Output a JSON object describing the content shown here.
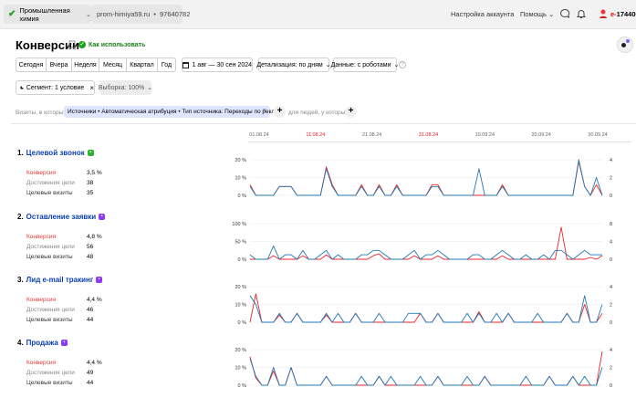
{
  "header": {
    "counter_label": "Промышленная химия",
    "site": "prom-himiya59.ru",
    "counter_id": "97640782",
    "account_settings": "Настройка аккаунта",
    "help": "Помощь",
    "user_id_prefix": "e-",
    "user_id": "1744009"
  },
  "page": {
    "title": "Конверсии",
    "how_to_use": "Как использовать"
  },
  "toolbar": {
    "periods": [
      "Сегодня",
      "Вчера",
      "Неделя",
      "Месяц",
      "Квартал",
      "Год"
    ],
    "date_range": "1 авг — 30 сен 2024",
    "detail": "Детализация: по дням",
    "data": "Данные: с роботами"
  },
  "segment": {
    "label": "Сегмент: 1 условие",
    "sample": "Выборка: 100%"
  },
  "filter": {
    "visits_prefix": "Визиты, в которых",
    "chip": "Источники • Автоматическая атрибуция • Тип источника: Переходы по рекламе",
    "people_suffix": "для людей, у которых"
  },
  "dates": [
    "01.08.24",
    "11.08.24",
    "21.08.24",
    "31.08.24",
    "10.09.24",
    "20.09.24",
    "30.09.24"
  ],
  "weekend_dates": [
    "11.08.24",
    "31.08.24"
  ],
  "metric_labels": {
    "conversion": "Конверсия",
    "reaches": "Достижения цели",
    "visits": "Целевые визиты"
  },
  "colors": {
    "conversion": "#e8262b",
    "visits": "#1f78b4",
    "link": "#0a3fae"
  },
  "goals": [
    {
      "number": "1.",
      "name": "Целевой звонок",
      "badge_icon": "phone-icon",
      "badge_color": "#2fb52f",
      "conversion": "3,5 %",
      "reaches": "38",
      "visits": "35",
      "left_axis": [
        "20 %",
        "10 %",
        "0 %"
      ],
      "right_axis": [
        "4",
        "2",
        "0"
      ],
      "conv_max": 20,
      "visits_max": 4,
      "conv_series": [
        6,
        0,
        0,
        0,
        0,
        5,
        5,
        5,
        0,
        0,
        0,
        0,
        0,
        16,
        6,
        0,
        0,
        0,
        0,
        6,
        0,
        0,
        6,
        0,
        0,
        6,
        0,
        0,
        0,
        0,
        0,
        6,
        6,
        0,
        0,
        0,
        0,
        0,
        0,
        0,
        0,
        0,
        0,
        6,
        0,
        0,
        0,
        0,
        0,
        0,
        0,
        0,
        0,
        0,
        0,
        0,
        19,
        5,
        0,
        6,
        0
      ],
      "visits_series": [
        1,
        0,
        0,
        0,
        0,
        1,
        1,
        1,
        0,
        0,
        0,
        0,
        0,
        3,
        1,
        0,
        0,
        0,
        0,
        1,
        0,
        0,
        1,
        0,
        0,
        1,
        0,
        0,
        0,
        0,
        0,
        1,
        1,
        0,
        0,
        0,
        0,
        0,
        0,
        3,
        0,
        0,
        0,
        1,
        0,
        0,
        0,
        0,
        0,
        0,
        0,
        0,
        0,
        0,
        0,
        0,
        4,
        1,
        0,
        2,
        0
      ]
    },
    {
      "number": "2.",
      "name": "Оставление заявки",
      "badge_icon": "form-icon",
      "badge_color": "#8a3cf6",
      "conversion": "4,8 %",
      "reaches": "56",
      "visits": "48",
      "left_axis": [
        "100 %",
        "50 %",
        "0 %"
      ],
      "right_axis": [
        "8",
        "4",
        "0"
      ],
      "conv_max": 100,
      "visits_max": 8,
      "conv_series": [
        0,
        0,
        0,
        0,
        10,
        0,
        0,
        0,
        0,
        10,
        0,
        0,
        0,
        12,
        0,
        0,
        0,
        0,
        0,
        0,
        0,
        10,
        15,
        0,
        0,
        0,
        0,
        0,
        10,
        0,
        0,
        0,
        10,
        0,
        0,
        0,
        0,
        0,
        0,
        0,
        0,
        0,
        0,
        10,
        0,
        0,
        0,
        0,
        0,
        0,
        0,
        0,
        0,
        90,
        0,
        0,
        0,
        0,
        5,
        0,
        10
      ],
      "visits_series": [
        1,
        0,
        0,
        0,
        3,
        0,
        1,
        1,
        0,
        2,
        0,
        0,
        1,
        2,
        0,
        1,
        0,
        0,
        0,
        1,
        1,
        2,
        2,
        1,
        0,
        0,
        0,
        1,
        2,
        0,
        1,
        1,
        2,
        1,
        0,
        0,
        0,
        0,
        1,
        1,
        0,
        0,
        1,
        2,
        1,
        0,
        0,
        1,
        0,
        0,
        1,
        0,
        2,
        2,
        1,
        0,
        1,
        2,
        1,
        1,
        1
      ]
    },
    {
      "number": "3.",
      "name": "Лид e-mail тракинг",
      "badge_icon": "mail-icon",
      "badge_color": "#8a3cf6",
      "conversion": "4,4 %",
      "reaches": "46",
      "visits": "44",
      "left_axis": [
        "20 %",
        "10 %",
        "0 %"
      ],
      "right_axis": [
        "4",
        "2",
        "0"
      ],
      "conv_max": 20,
      "visits_max": 4,
      "conv_series": [
        0,
        16,
        0,
        0,
        0,
        4,
        0,
        0,
        5,
        0,
        0,
        0,
        0,
        4,
        0,
        0,
        0,
        0,
        5,
        0,
        0,
        0,
        0,
        0,
        0,
        0,
        0,
        0,
        0,
        5,
        0,
        0,
        5,
        0,
        0,
        0,
        0,
        0,
        0,
        6,
        0,
        0,
        0,
        0,
        5,
        0,
        0,
        0,
        0,
        0,
        0,
        0,
        0,
        0,
        5,
        0,
        0,
        10,
        0,
        0,
        5
      ],
      "visits_series": [
        3,
        2,
        0,
        0,
        0,
        1,
        0,
        0,
        1,
        0,
        0,
        0,
        0,
        1,
        0,
        1,
        0,
        0,
        1,
        0,
        0,
        0,
        1,
        0,
        0,
        0,
        0,
        1,
        1,
        1,
        0,
        0,
        1,
        0,
        0,
        0,
        0,
        1,
        0,
        1,
        0,
        0,
        1,
        0,
        1,
        0,
        0,
        0,
        0,
        1,
        0,
        0,
        0,
        0,
        1,
        0,
        0,
        3,
        0,
        0,
        2
      ]
    },
    {
      "number": "4.",
      "name": "Продажа",
      "badge_icon": "cart-icon",
      "badge_color": "#8a3cf6",
      "conversion": "4,4 %",
      "reaches": "49",
      "visits": "44",
      "left_axis": [
        "20 %",
        "10 %",
        "0 %"
      ],
      "right_axis": [
        "4",
        "2",
        "0"
      ],
      "conv_max": 20,
      "visits_max": 4,
      "conv_series": [
        16,
        4,
        0,
        0,
        8,
        0,
        0,
        10,
        0,
        0,
        0,
        0,
        0,
        5,
        0,
        0,
        0,
        0,
        0,
        0,
        0,
        0,
        5,
        0,
        0,
        0,
        0,
        0,
        0,
        0,
        0,
        0,
        5,
        0,
        0,
        0,
        0,
        0,
        0,
        0,
        5,
        0,
        0,
        0,
        0,
        0,
        0,
        0,
        0,
        0,
        0,
        5,
        0,
        0,
        0,
        5,
        0,
        0,
        0,
        0,
        19
      ],
      "visits_series": [
        3,
        1,
        0,
        0,
        2,
        0,
        0,
        2,
        0,
        0,
        0,
        0,
        0,
        1,
        0,
        0,
        0,
        0,
        0,
        1,
        0,
        0,
        1,
        0,
        1,
        0,
        0,
        0,
        0,
        1,
        0,
        0,
        1,
        0,
        0,
        0,
        0,
        1,
        0,
        0,
        1,
        0,
        0,
        0,
        0,
        0,
        0,
        1,
        0,
        0,
        0,
        1,
        0,
        0,
        0,
        1,
        0,
        1,
        0,
        0,
        2
      ]
    }
  ]
}
